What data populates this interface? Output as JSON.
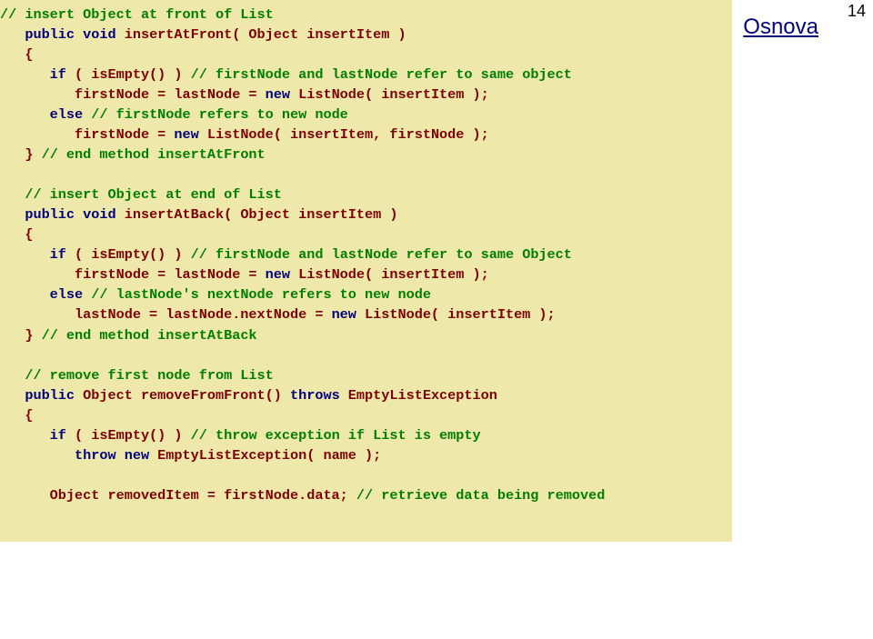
{
  "page_number": "14",
  "header_link": "Osnova",
  "code": {
    "l1": "// insert Object at front of List",
    "l2a": "   public void",
    "l2b": " insertAtFront( Object insertItem )",
    "l3": "   {",
    "l4a": "      if",
    "l4b": " ( isEmpty() ) ",
    "l4c": "// firstNode and lastNode refer to same object",
    "l5a": "         firstNode = lastNode = ",
    "l5b": "new",
    "l5c": " ListNode( insertItem );",
    "l6a": "      else ",
    "l6b": "// firstNode refers to new node",
    "l7a": "         firstNode = ",
    "l7b": "new",
    "l7c": " ListNode( insertItem, firstNode );",
    "l8a": "   } ",
    "l8b": "// end method insertAtFront",
    "l9": "",
    "l10": "   // insert Object at end of List",
    "l11a": "   public void",
    "l11b": " insertAtBack( Object insertItem )",
    "l12": "   {",
    "l13a": "      if",
    "l13b": " ( isEmpty() ) ",
    "l13c": "// firstNode and lastNode refer to same Object",
    "l14a": "         firstNode = lastNode = ",
    "l14b": "new",
    "l14c": " ListNode( insertItem );",
    "l15a": "      else ",
    "l15b": "// lastNode's nextNode refers to new node",
    "l16a": "         lastNode = lastNode.nextNode = ",
    "l16b": "new",
    "l16c": " ListNode( insertItem );",
    "l17a": "   } ",
    "l17b": "// end method insertAtBack",
    "l18": "",
    "l19": "   // remove first node from List",
    "l20a": "   public",
    "l20b": " Object removeFromFront() ",
    "l20c": "throws",
    "l20d": " EmptyListException",
    "l21": "   {",
    "l22a": "      if",
    "l22b": " ( isEmpty() ) ",
    "l22c": "// throw exception if List is empty",
    "l23a": "         throw new",
    "l23b": " EmptyListException( name );",
    "l24": "",
    "l25a": "      Object removedItem = firstNode.data; ",
    "l25b": "// retrieve data being removed"
  }
}
